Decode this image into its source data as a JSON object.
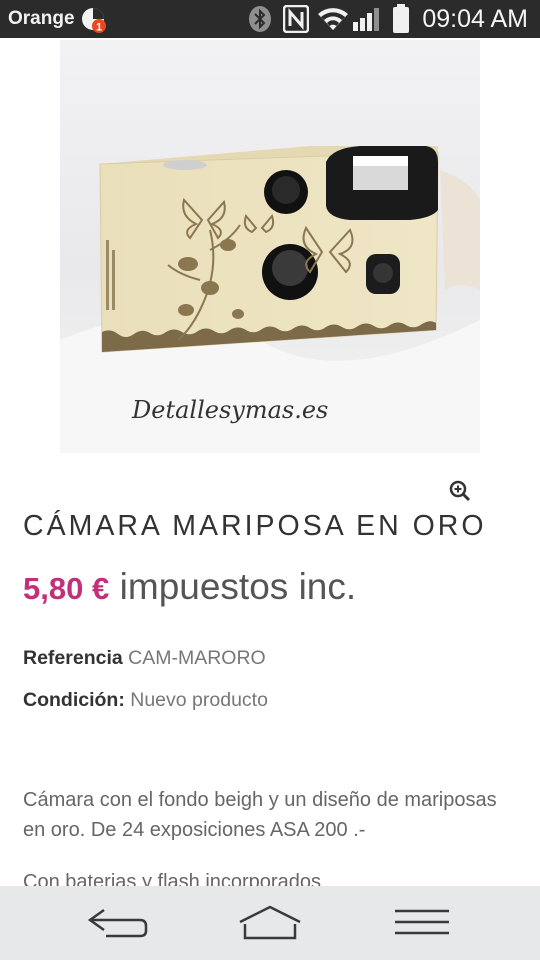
{
  "status_bar": {
    "carrier": "Orange",
    "notification_badge": "1",
    "time": "09:04 AM",
    "icons": [
      "bluetooth-icon",
      "nfc-icon",
      "wifi-icon",
      "signal-icon",
      "battery-icon"
    ]
  },
  "product": {
    "image_watermark": "Detallesymas.es",
    "title": "CÁMARA MARIPOSA EN ORO",
    "price": "5,80 €",
    "tax_label": "impuestos inc.",
    "reference_label": "Referencia",
    "reference_value": "CAM-MARORO",
    "condition_label": "Condición:",
    "condition_value": "Nuevo producto",
    "description_1": "Cámara con el fondo beigh y un diseño de mariposas en oro. De 24 exposiciones ASA 200 .-",
    "description_2": "Con baterias y flash incorporados"
  },
  "nav_bar": {
    "buttons": [
      "back-button",
      "home-button",
      "menu-button"
    ]
  },
  "colors": {
    "price": "#c2307a",
    "status_bar": "#2b2b2b",
    "nav_bar": "#e6e8e9"
  }
}
